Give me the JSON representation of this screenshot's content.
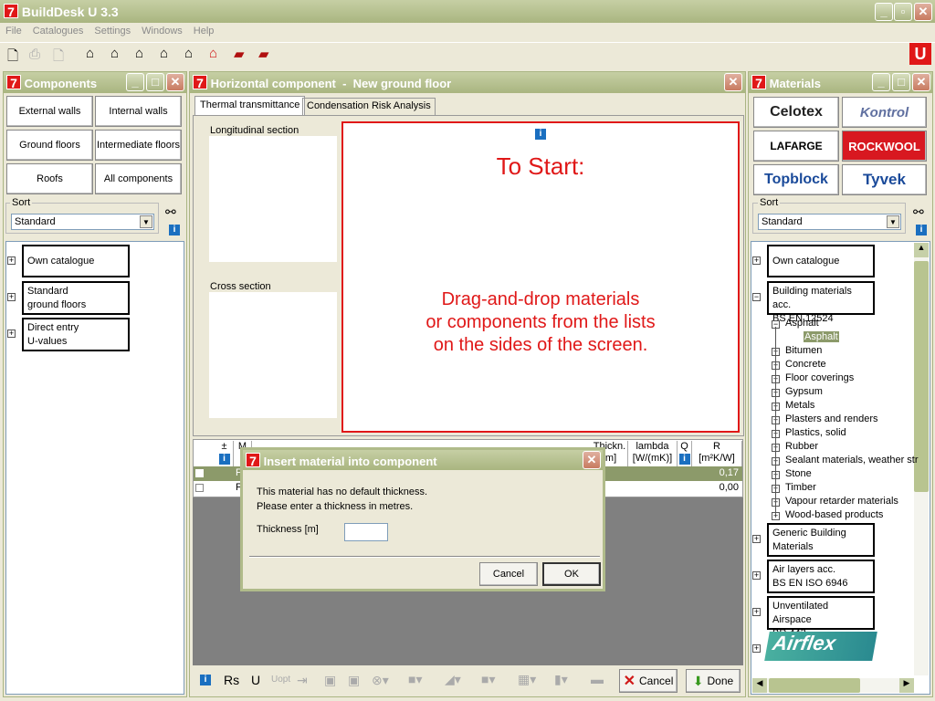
{
  "app": {
    "title": "BuildDesk U 3.3"
  },
  "menu": [
    "File",
    "Catalogues",
    "Settings",
    "Windows",
    "Help"
  ],
  "toolbar": {
    "icons": [
      "new-document-icon",
      "print-icon",
      "print-preview-icon",
      "house-external-wall-icon",
      "house-internal-wall-icon",
      "house-ground-floor-icon",
      "house-intermediate-floor-icon",
      "house-roof-icon",
      "house-open-icon",
      "bricks-new-icon",
      "bricks-open-icon"
    ]
  },
  "components": {
    "title": "Components",
    "buttons": [
      "External walls",
      "Internal walls",
      "Ground floors",
      "Intermediate floors",
      "Roofs",
      "All components"
    ],
    "sort_label": "Sort",
    "sort_value": "Standard",
    "tree": [
      "Own catalogue",
      "Standard\nground floors",
      "Direct entry\nU-values"
    ]
  },
  "center": {
    "title": "Horizontal component  -  New ground floor",
    "tabs": [
      "Thermal transmittance",
      "Condensation Risk Analysis"
    ],
    "longitudinal": "Longitudinal section",
    "cross": "Cross section",
    "start_title": "To Start:",
    "start_text": "Drag-and-drop materials\nor components from the lists\non the sides of the screen.",
    "table": {
      "headers": [
        "±",
        "M",
        "Thickn.\n[m]",
        "lambda\n[W/(mK)]",
        "Q",
        "R\n[m²K/W]"
      ],
      "rows": [
        {
          "name": "F",
          "r": "0,17"
        },
        {
          "name": "F",
          "r": "0,00"
        }
      ]
    },
    "bottom": {
      "rs": "Rs",
      "u": "U",
      "uopt": "Uopt",
      "cancel": "Cancel",
      "done": "Done"
    }
  },
  "materials": {
    "title": "Materials",
    "brands": [
      "Celotex",
      "Kontrol",
      "LAFARGE",
      "ROCKWOOL",
      "Topblock",
      "Tyvek"
    ],
    "sort_label": "Sort",
    "sort_value": "Standard",
    "catalogues": [
      "Own catalogue",
      "Building materials acc.\nBS EN 12524",
      "Generic Building\nMaterials",
      "Air layers acc.\nBS EN ISO 6946",
      "Unventilated Airspace\nBR 443"
    ],
    "subtree": [
      "Asphalt",
      "Asphalt",
      "Bitumen",
      "Concrete",
      "Floor coverings",
      "Gypsum",
      "Metals",
      "Plasters and renders",
      "Plastics, solid",
      "Rubber",
      "Sealant materials, weather str",
      "Stone",
      "Timber",
      "Vapour retarder materials",
      "Wood-based products"
    ],
    "airflex": "Airflex"
  },
  "dialog": {
    "title": "Insert material into component",
    "line1": "This material has no default thickness.",
    "line2": "Please enter a thickness in metres.",
    "label": "Thickness [m]",
    "value": "",
    "cancel": "Cancel",
    "ok": "OK"
  },
  "colors": {
    "accent": "#e01818",
    "selected": "#8c9a6a",
    "title": "#a9b580"
  }
}
